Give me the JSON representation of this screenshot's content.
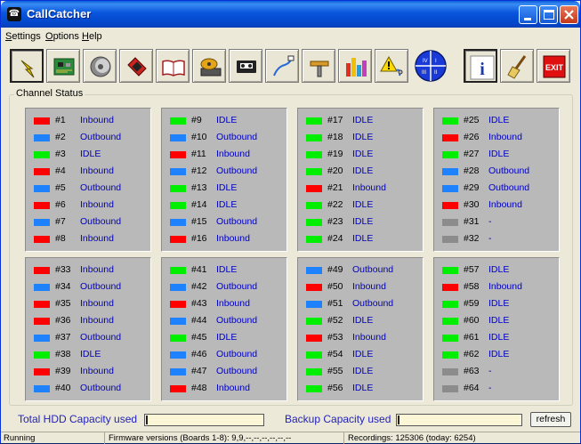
{
  "window": {
    "title": "CallCatcher"
  },
  "menu": [
    {
      "label": "Settings",
      "underline": "S",
      "rest": "ettings"
    },
    {
      "label": "Options",
      "underline": "O",
      "rest": "ptions"
    },
    {
      "label": "Help",
      "underline": "H",
      "rest": "elp"
    }
  ],
  "toolbar": [
    {
      "name": "lightning-icon"
    },
    {
      "name": "circuit-board-icon"
    },
    {
      "name": "disc-icon"
    },
    {
      "name": "telephone-icon"
    },
    {
      "name": "book-icon"
    },
    {
      "name": "harddisk-icon"
    },
    {
      "name": "cassette-icon"
    },
    {
      "name": "network-cable-icon"
    },
    {
      "name": "tools-icon"
    },
    {
      "name": "bar-chart-icon"
    },
    {
      "name": "warning-icon"
    },
    {
      "name": "sector-dial-icon",
      "labels": [
        "IV",
        "I",
        "III",
        "II"
      ]
    },
    {
      "name": "info-icon",
      "label": "i"
    },
    {
      "name": "broom-icon"
    },
    {
      "name": "exit-icon",
      "label": "EXIT"
    }
  ],
  "channel_status": {
    "title": "Channel Status",
    "status_colors": {
      "Inbound": "#ff0000",
      "Outbound": "#1e82ff",
      "IDLE": "#00ee00",
      "-": "#8c8c8c"
    },
    "panels": [
      [
        {
          "num": "#1",
          "status": "Inbound"
        },
        {
          "num": "#2",
          "status": "Outbound"
        },
        {
          "num": "#3",
          "status": "IDLE"
        },
        {
          "num": "#4",
          "status": "Inbound"
        },
        {
          "num": "#5",
          "status": "Outbound"
        },
        {
          "num": "#6",
          "status": "Inbound"
        },
        {
          "num": "#7",
          "status": "Outbound"
        },
        {
          "num": "#8",
          "status": "Inbound"
        }
      ],
      [
        {
          "num": "#9",
          "status": "IDLE"
        },
        {
          "num": "#10",
          "status": "Outbound"
        },
        {
          "num": "#11",
          "status": "Inbound"
        },
        {
          "num": "#12",
          "status": "Outbound"
        },
        {
          "num": "#13",
          "status": "IDLE"
        },
        {
          "num": "#14",
          "status": "IDLE"
        },
        {
          "num": "#15",
          "status": "Outbound"
        },
        {
          "num": "#16",
          "status": "Inbound"
        }
      ],
      [
        {
          "num": "#17",
          "status": "IDLE"
        },
        {
          "num": "#18",
          "status": "IDLE"
        },
        {
          "num": "#19",
          "status": "IDLE"
        },
        {
          "num": "#20",
          "status": "IDLE"
        },
        {
          "num": "#21",
          "status": "Inbound"
        },
        {
          "num": "#22",
          "status": "IDLE"
        },
        {
          "num": "#23",
          "status": "IDLE"
        },
        {
          "num": "#24",
          "status": "IDLE"
        }
      ],
      [
        {
          "num": "#25",
          "status": "IDLE"
        },
        {
          "num": "#26",
          "status": "Inbound"
        },
        {
          "num": "#27",
          "status": "IDLE"
        },
        {
          "num": "#28",
          "status": "Outbound"
        },
        {
          "num": "#29",
          "status": "Outbound"
        },
        {
          "num": "#30",
          "status": "Inbound"
        },
        {
          "num": "#31",
          "status": "-"
        },
        {
          "num": "#32",
          "status": "-"
        }
      ],
      [
        {
          "num": "#33",
          "status": "Inbound"
        },
        {
          "num": "#34",
          "status": "Outbound"
        },
        {
          "num": "#35",
          "status": "Inbound"
        },
        {
          "num": "#36",
          "status": "Inbound"
        },
        {
          "num": "#37",
          "status": "Outbound"
        },
        {
          "num": "#38",
          "status": "IDLE"
        },
        {
          "num": "#39",
          "status": "Inbound"
        },
        {
          "num": "#40",
          "status": "Outbound"
        }
      ],
      [
        {
          "num": "#41",
          "status": "IDLE"
        },
        {
          "num": "#42",
          "status": "Outbound"
        },
        {
          "num": "#43",
          "status": "Inbound"
        },
        {
          "num": "#44",
          "status": "Outbound"
        },
        {
          "num": "#45",
          "status": "IDLE"
        },
        {
          "num": "#46",
          "status": "Outbound"
        },
        {
          "num": "#47",
          "status": "Outbound"
        },
        {
          "num": "#48",
          "status": "Inbound"
        }
      ],
      [
        {
          "num": "#49",
          "status": "Outbound"
        },
        {
          "num": "#50",
          "status": "Inbound"
        },
        {
          "num": "#51",
          "status": "Outbound"
        },
        {
          "num": "#52",
          "status": "IDLE"
        },
        {
          "num": "#53",
          "status": "Inbound"
        },
        {
          "num": "#54",
          "status": "IDLE"
        },
        {
          "num": "#55",
          "status": "IDLE"
        },
        {
          "num": "#56",
          "status": "IDLE"
        }
      ],
      [
        {
          "num": "#57",
          "status": "IDLE"
        },
        {
          "num": "#58",
          "status": "Inbound"
        },
        {
          "num": "#59",
          "status": "IDLE"
        },
        {
          "num": "#60",
          "status": "IDLE"
        },
        {
          "num": "#61",
          "status": "IDLE"
        },
        {
          "num": "#62",
          "status": "IDLE"
        },
        {
          "num": "#63",
          "status": "-"
        },
        {
          "num": "#64",
          "status": "-"
        }
      ]
    ]
  },
  "capacity": {
    "hdd_label": "Total HDD Capacity used",
    "hdd_used_fraction": 0.01,
    "backup_label": "Backup Capacity used",
    "backup_used_fraction": 0.01,
    "refresh_label": "refresh"
  },
  "statusbar": {
    "state": "Running",
    "firmware": "Firmware versions (Boards 1-8): 9,9,--,--,--,--,--,--",
    "recordings": "Recordings: 125306 (today: 6254)"
  }
}
